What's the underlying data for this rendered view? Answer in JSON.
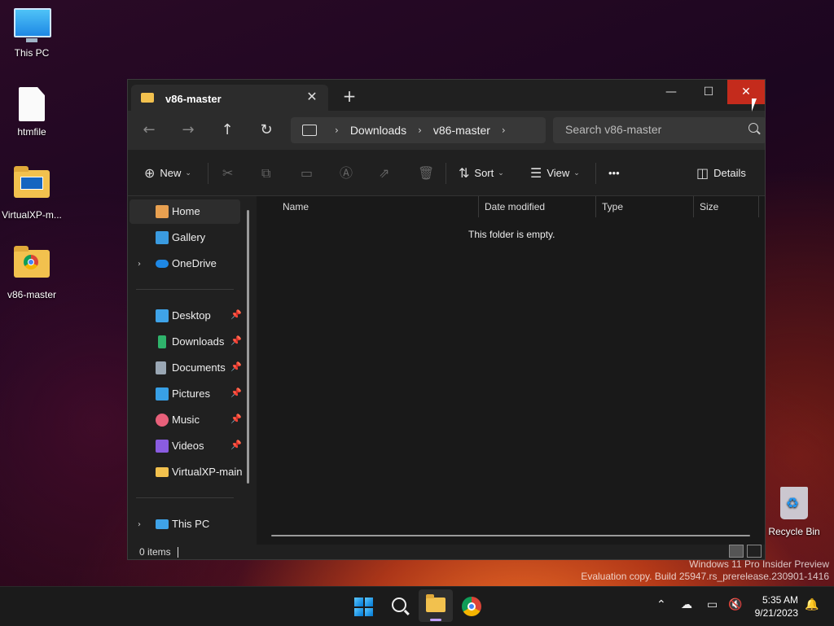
{
  "desktop": {
    "icons": [
      {
        "label": "This PC",
        "icon": "monitor-icon"
      },
      {
        "label": "htmfile",
        "icon": "file-icon"
      },
      {
        "label": "VirtualXP-m...",
        "icon": "folder-icon"
      },
      {
        "label": "v86-master",
        "icon": "folder-chrome-icon"
      },
      {
        "label": "Recycle Bin",
        "icon": "recycle-bin-icon"
      }
    ],
    "watermark": {
      "line1": "Windows 11 Pro Insider Preview",
      "line2": "Evaluation copy. Build 25947.rs_prerelease.230901-1416"
    }
  },
  "window": {
    "tab_title": "v86-master",
    "tab_close": "✕",
    "new_tab": "+",
    "controls": {
      "minimize": "—",
      "maximize": "☐",
      "close": "✕"
    },
    "nav": {
      "back": "←",
      "forward": "→",
      "up": "↑",
      "refresh": "↻"
    },
    "breadcrumbs": [
      "Downloads",
      "v86-master"
    ],
    "crumb_sep": "›",
    "search_placeholder": "Search v86-master",
    "commands": {
      "new": "New",
      "sort": "Sort",
      "view": "View",
      "more": "•••",
      "details": "Details"
    },
    "sidebar": {
      "quick": [
        {
          "label": "Home",
          "icon": "home-icon"
        },
        {
          "label": "Gallery",
          "icon": "gallery-icon"
        },
        {
          "label": "OneDrive",
          "icon": "onedrive-icon"
        }
      ],
      "pinned": [
        {
          "label": "Desktop",
          "icon": "desktop-icon"
        },
        {
          "label": "Downloads",
          "icon": "downloads-icon"
        },
        {
          "label": "Documents",
          "icon": "documents-icon"
        },
        {
          "label": "Pictures",
          "icon": "pictures-icon"
        },
        {
          "label": "Music",
          "icon": "music-icon"
        },
        {
          "label": "Videos",
          "icon": "videos-icon"
        },
        {
          "label": "VirtualXP-main",
          "icon": "folder-icon"
        }
      ],
      "this_pc": "This PC"
    },
    "columns": [
      "Name",
      "Date modified",
      "Type",
      "Size"
    ],
    "empty_message": "This folder is empty.",
    "status": {
      "count": "0 items"
    }
  },
  "taskbar": {
    "time": "5:35 AM",
    "date": "9/21/2023"
  },
  "colors": {
    "window_bg": "#202020",
    "close_red": "#c42b1c",
    "folder_yellow": "#f2c14e",
    "accent_blue": "#0078d4"
  }
}
